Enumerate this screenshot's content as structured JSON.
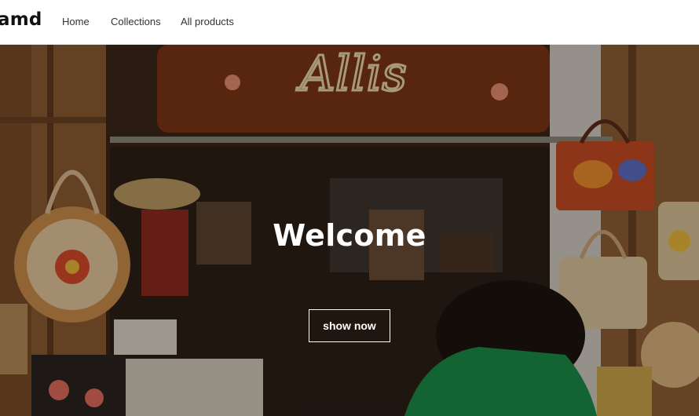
{
  "header": {
    "logo": "amd",
    "nav": [
      {
        "label": "Home"
      },
      {
        "label": "Collections"
      },
      {
        "label": "All products"
      }
    ]
  },
  "hero": {
    "title": "Welcome",
    "button_label": "show now",
    "sign_text": "Allis",
    "image_alt": "handmade bags market stall"
  },
  "colors": {
    "header_bg": "#ffffff",
    "text": "#111111",
    "hero_text": "#ffffff"
  }
}
